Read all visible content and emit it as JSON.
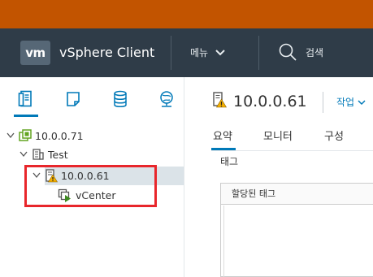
{
  "header": {
    "logo_text": "vm",
    "app_title": "vSphere Client",
    "menu_label": "메뉴",
    "search_label": "검색"
  },
  "left_tabs": [
    {
      "name": "hosts-and-clusters",
      "icon": "hosts-clusters-icon",
      "active": true
    },
    {
      "name": "vms-and-templates",
      "icon": "vms-templates-icon",
      "active": false
    },
    {
      "name": "storage",
      "icon": "storage-icon",
      "active": false
    },
    {
      "name": "networking",
      "icon": "networking-icon",
      "active": false
    }
  ],
  "tree": {
    "vcenter_root": "10.0.0.71",
    "datacenter": "Test",
    "host": "10.0.0.61",
    "vm": "vCenter"
  },
  "object": {
    "title": "10.0.0.61",
    "actions_label": "작업"
  },
  "tabs": [
    {
      "label": "요약",
      "active": true
    },
    {
      "label": "모니터",
      "active": false
    },
    {
      "label": "구성",
      "active": false
    }
  ],
  "tags_section": {
    "title": "태그",
    "column_header": "할당된 태그"
  },
  "colors": {
    "topbar": "#c25400",
    "header_bg": "#2f3c48",
    "accent": "#0079b8",
    "highlight_box": "#e8262b",
    "selection_bg": "#dbe3e8"
  }
}
